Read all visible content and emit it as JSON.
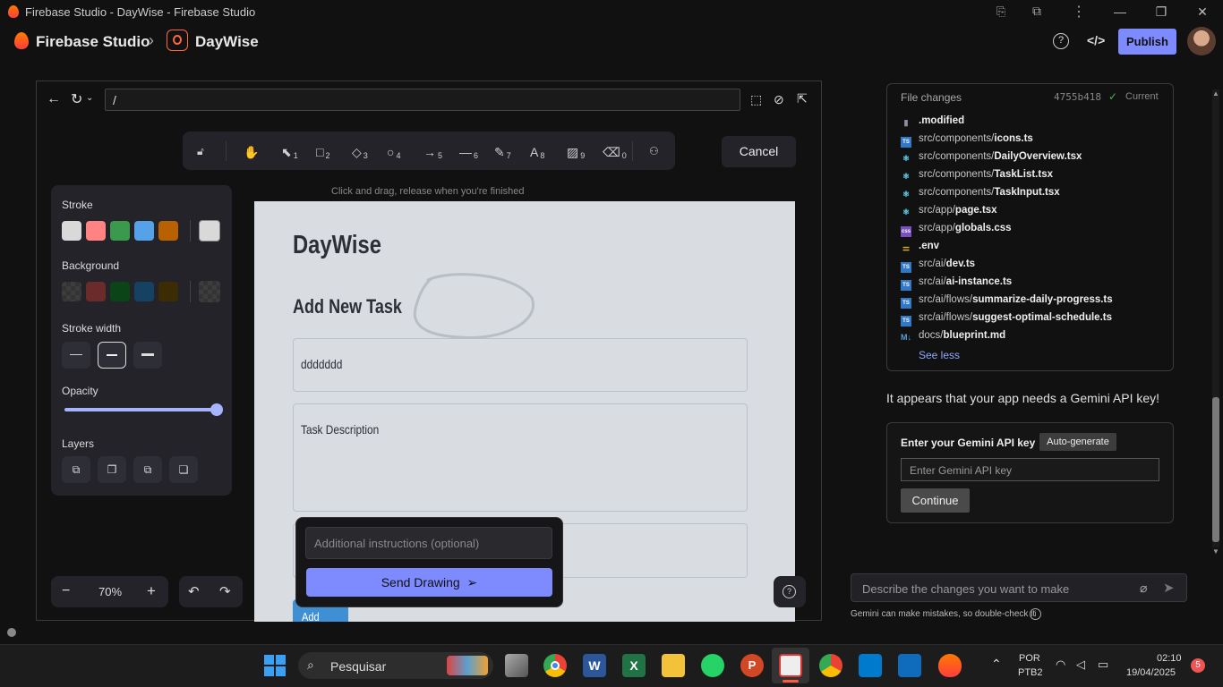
{
  "window": {
    "title": "Firebase Studio - DayWise - Firebase Studio"
  },
  "header": {
    "brand": "Firebase Studio",
    "chevron": "›",
    "project": "DayWise",
    "publish": "Publish"
  },
  "preview": {
    "url": "/",
    "toolbar": {
      "tools": [
        {
          "icon": "hand-icon",
          "glyph": "✋",
          "key": ""
        },
        {
          "icon": "select-icon",
          "glyph": "⬉",
          "key": "1"
        },
        {
          "icon": "rectangle-icon",
          "glyph": "□",
          "key": "2"
        },
        {
          "icon": "diamond-icon",
          "glyph": "◇",
          "key": "3"
        },
        {
          "icon": "ellipse-icon",
          "glyph": "○",
          "key": "4"
        },
        {
          "icon": "arrow-icon",
          "glyph": "→",
          "key": "5"
        },
        {
          "icon": "line-icon",
          "glyph": "—",
          "key": "6"
        },
        {
          "icon": "pencil-icon",
          "glyph": "✎",
          "key": "7"
        },
        {
          "icon": "text-icon",
          "glyph": "A",
          "key": "8"
        },
        {
          "icon": "image-icon",
          "glyph": "▨",
          "key": "9"
        },
        {
          "icon": "eraser-icon",
          "glyph": "⌫",
          "key": "0"
        }
      ]
    },
    "cancel": "Cancel",
    "hint": "Click and drag, release when you're finished",
    "props": {
      "stroke": "Stroke",
      "stroke_colors": [
        "#d9d9d9",
        "#ff8383",
        "#3a994c",
        "#56a2e8",
        "#b76100"
      ],
      "stroke_selected": "#d9d9d9",
      "background": "Background",
      "bg_colors": [
        "transparent",
        "#6b2b2b",
        "#0b4416",
        "#154163",
        "#3b2c03"
      ],
      "stroke_width": "Stroke width",
      "opacity": "Opacity",
      "opacity_value": 1.0,
      "layers": "Layers"
    },
    "zoom": {
      "value": "70%",
      "minus": "−",
      "plus": "+"
    },
    "app": {
      "title": "DayWise",
      "section": "Add New Task",
      "task_name": "ddddddd",
      "task_description": "Task Description",
      "add_button": "Add Task"
    },
    "popover": {
      "placeholder": "Additional instructions (optional)",
      "send": "Send Drawing"
    }
  },
  "right": {
    "file_changes": "File changes",
    "commit": "4755b418",
    "current": "Current",
    "files": [
      {
        "icon": "file-icon",
        "color": "#8a8fa3",
        "dir": "",
        "name": ".modified"
      },
      {
        "icon": "ts-icon",
        "color": "#3178c6",
        "dir": "src/components/",
        "name": "icons.ts"
      },
      {
        "icon": "react-icon",
        "color": "#61dafb",
        "dir": "src/components/",
        "name": "DailyOverview.tsx"
      },
      {
        "icon": "react-icon",
        "color": "#61dafb",
        "dir": "src/components/",
        "name": "TaskList.tsx"
      },
      {
        "icon": "react-icon",
        "color": "#61dafb",
        "dir": "src/components/",
        "name": "TaskInput.tsx"
      },
      {
        "icon": "react-icon",
        "color": "#61dafb",
        "dir": "src/app/",
        "name": "page.tsx"
      },
      {
        "icon": "css-icon",
        "color": "#7a4fbf",
        "dir": "src/app/",
        "name": "globals.css"
      },
      {
        "icon": "env-icon",
        "color": "#e0b321",
        "dir": "",
        "name": ".env"
      },
      {
        "icon": "ts-icon",
        "color": "#3178c6",
        "dir": "src/ai/",
        "name": "dev.ts"
      },
      {
        "icon": "ts-icon",
        "color": "#3178c6",
        "dir": "src/ai/",
        "name": "ai-instance.ts"
      },
      {
        "icon": "ts-icon",
        "color": "#3178c6",
        "dir": "src/ai/flows/",
        "name": "summarize-daily-progress.ts"
      },
      {
        "icon": "ts-icon",
        "color": "#3178c6",
        "dir": "src/ai/flows/",
        "name": "suggest-optimal-schedule.ts"
      },
      {
        "icon": "markdown-icon",
        "color": "#5b9bd5",
        "dir": "docs/",
        "name": "blueprint.md"
      }
    ],
    "see_less": "See less",
    "message": "It appears that your app needs a Gemini API key!",
    "api": {
      "label": "Enter your Gemini API key",
      "auto": "Auto-generate",
      "placeholder": "Enter Gemini API key",
      "continue": "Continue"
    },
    "chat_placeholder": "Describe the changes you want to make",
    "disclaimer": "Gemini can make mistakes, so double-check it"
  },
  "taskbar": {
    "search": "Pesquisar",
    "lang1": "POR",
    "lang2": "PTB2",
    "time": "02:10",
    "date": "19/04/2025",
    "badge": "5"
  }
}
